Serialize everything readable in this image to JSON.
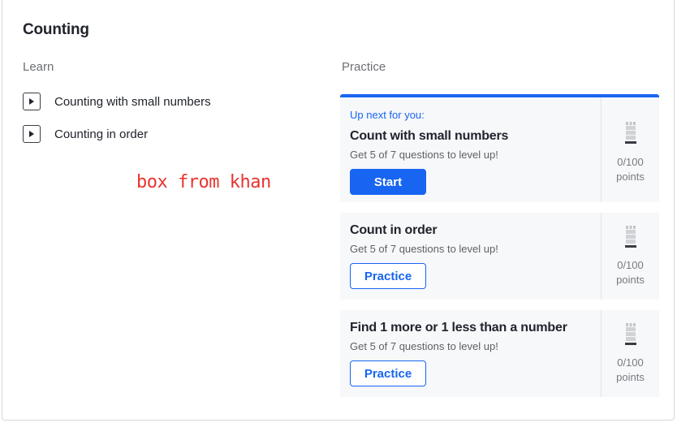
{
  "section": {
    "title": "Counting",
    "learn_heading": "Learn",
    "practice_heading": "Practice"
  },
  "learn": {
    "videos": [
      {
        "label": "Counting with small numbers",
        "icon": "play-icon"
      },
      {
        "label": "Counting in order",
        "icon": "play-icon"
      }
    ]
  },
  "annotation": {
    "text": "box from khan",
    "color": "#e8342f"
  },
  "practice": {
    "up_next_label": "Up next for you:",
    "skills": [
      {
        "title": "Count with small numbers",
        "subtitle": "Get 5 of 7 questions to level up!",
        "button": "Start",
        "points": "0/100",
        "points_unit": "points"
      },
      {
        "title": "Count in order",
        "subtitle": "Get 5 of 7 questions to level up!",
        "button": "Practice",
        "points": "0/100",
        "points_unit": "points"
      },
      {
        "title": "Find 1 more or 1 less than a number",
        "subtitle": "Get 5 of 7 questions to level up!",
        "button": "Practice",
        "points": "0/100",
        "points_unit": "points"
      }
    ]
  },
  "colors": {
    "accent": "#1865f2",
    "panel": "#f7f8fa",
    "annotation": "#e8342f"
  }
}
